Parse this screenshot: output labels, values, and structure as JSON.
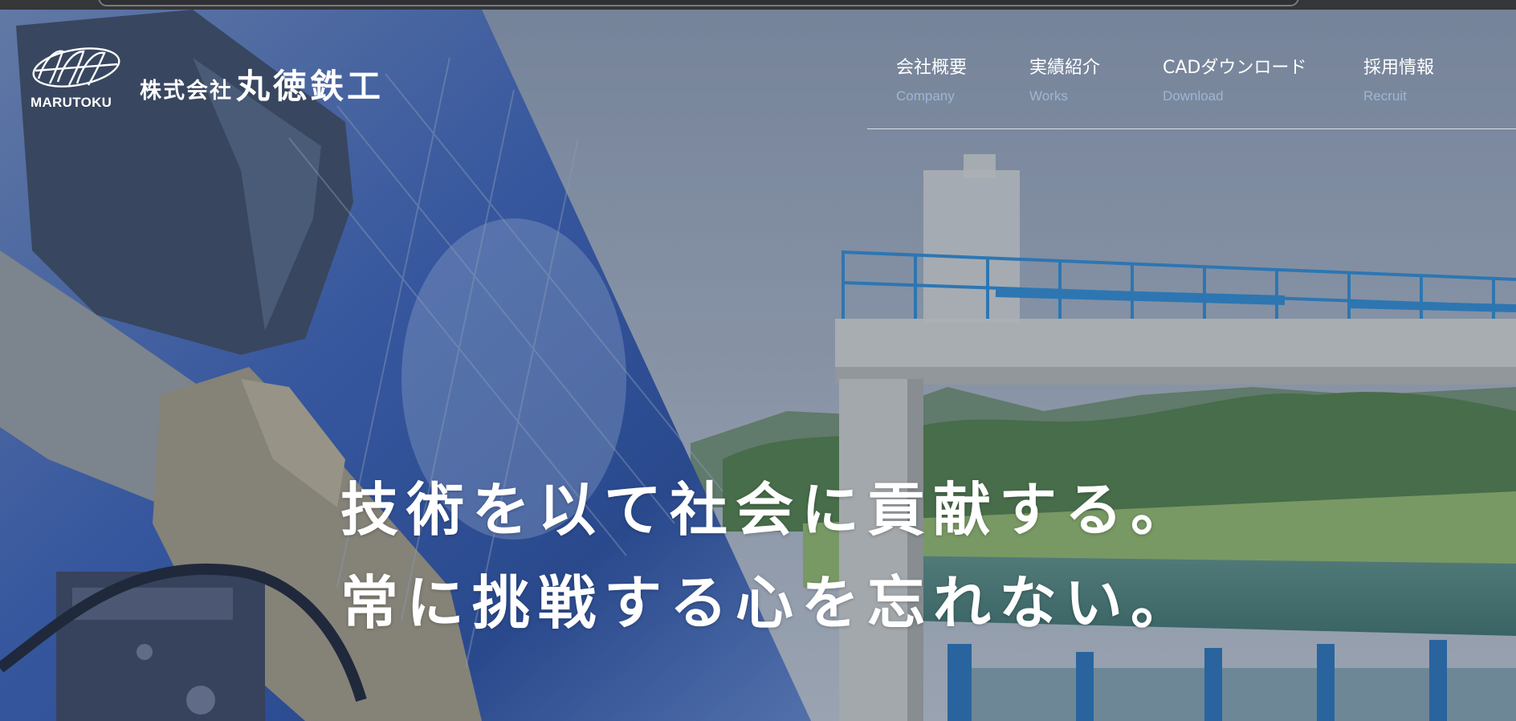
{
  "header": {
    "logo": {
      "name_en": "MARUTOKU",
      "name_prefix_ja": "株式会社",
      "name_ja": "丸徳鉄工"
    },
    "nav": [
      {
        "ja": "会社概要",
        "en": "Company"
      },
      {
        "ja": "実績紹介",
        "en": "Works"
      },
      {
        "ja": "CADダウンロード",
        "en": "Download"
      },
      {
        "ja": "採用情報",
        "en": "Recruit"
      }
    ]
  },
  "hero": {
    "line1": "技術を以て社会に貢献する。",
    "line2": "常に挑戦する心を忘れない。"
  },
  "colors": {
    "nav_subtitle": "#9db6d6",
    "text": "#ffffff",
    "railing": "#2f86c9"
  }
}
